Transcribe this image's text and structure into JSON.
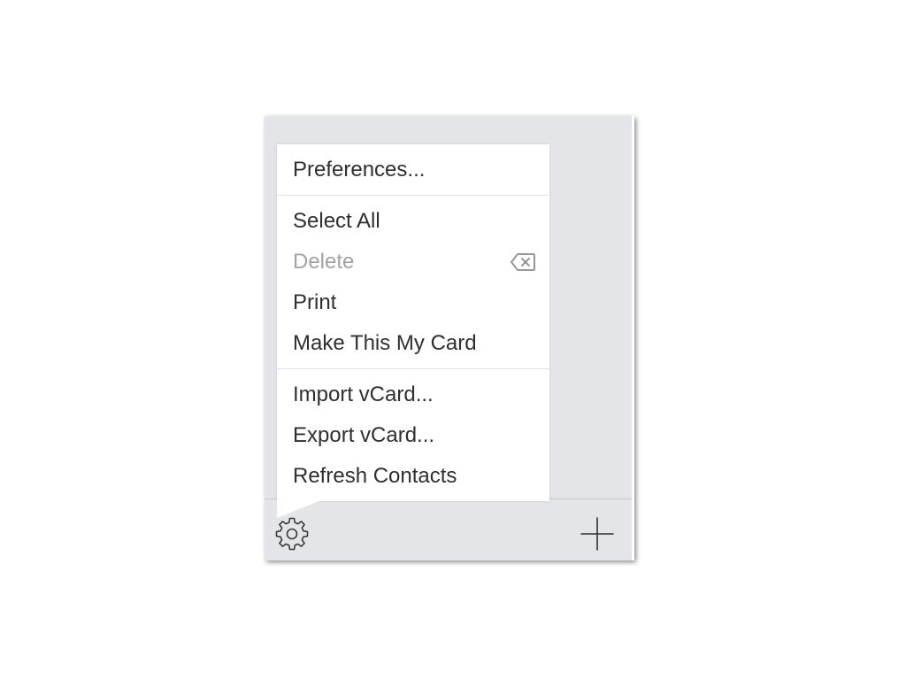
{
  "menu": {
    "preferences": "Preferences...",
    "select_all": "Select All",
    "delete": "Delete",
    "delete_shortcut_icon": "delete-backward-icon",
    "print": "Print",
    "make_my_card": "Make This My Card",
    "import_vcard": "Import vCard...",
    "export_vcard": "Export vCard...",
    "refresh_contacts": "Refresh Contacts"
  },
  "toolbar": {
    "settings_icon": "gear-icon",
    "add_icon": "plus-icon"
  },
  "colors": {
    "panel_background": "#e3e5e8",
    "menu_background": "#ffffff",
    "text": "#2f2f2f",
    "disabled_text": "#a3a3a3"
  }
}
